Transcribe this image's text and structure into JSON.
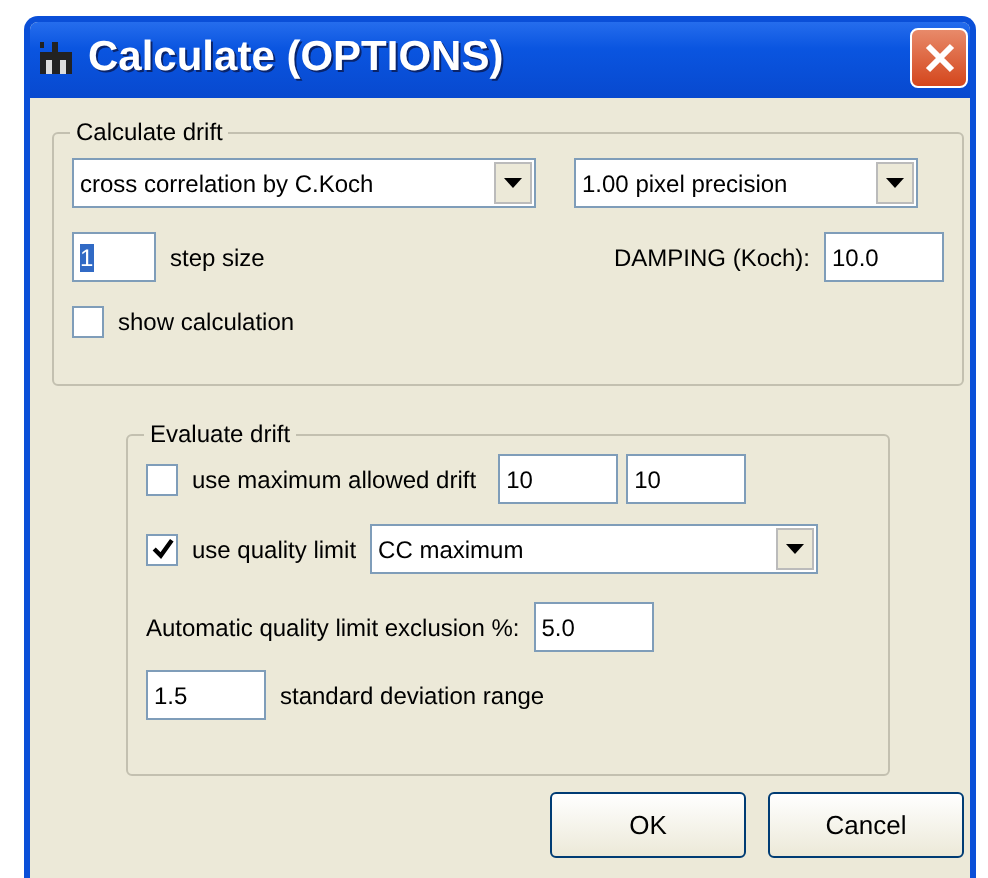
{
  "window": {
    "title": "Calculate (OPTIONS)"
  },
  "calculate_drift": {
    "title": "Calculate drift",
    "method": {
      "value": "cross correlation by C.Koch"
    },
    "precision": {
      "value": "1.00 pixel precision"
    },
    "step_size": {
      "value": "1",
      "label": "step size",
      "selected": true
    },
    "damping": {
      "label": "DAMPING (Koch):",
      "value": "10.0"
    },
    "show_calculation": {
      "label": "show calculation",
      "checked": false
    }
  },
  "evaluate_drift": {
    "title": "Evaluate drift",
    "max_drift": {
      "label": "use maximum allowed drift",
      "checked": false,
      "values": [
        "10",
        "10"
      ]
    },
    "quality_limit": {
      "label": "use quality limit",
      "checked": true,
      "value": "CC maximum"
    },
    "exclusion": {
      "label": "Automatic quality limit exclusion %:",
      "value": "5.0"
    },
    "std_range": {
      "value": "1.5",
      "label": "standard deviation range"
    }
  },
  "buttons": [
    "OK",
    "Cancel"
  ]
}
